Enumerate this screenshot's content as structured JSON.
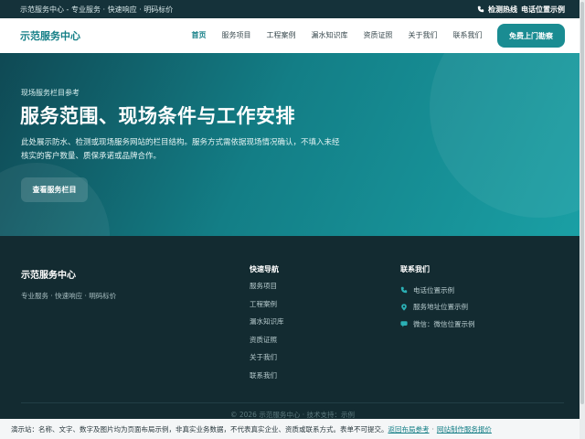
{
  "topbar": {
    "left_text": "示范服务中心 - 专业服务 · 快速响应 · 明码标价",
    "hotline_label": "检测热线",
    "hotline_value": "电话位置示例"
  },
  "header": {
    "logo": "示范服务中心",
    "nav": [
      {
        "label": "首页",
        "active": true
      },
      {
        "label": "服务项目",
        "active": false
      },
      {
        "label": "工程案例",
        "active": false
      },
      {
        "label": "漏水知识库",
        "active": false
      },
      {
        "label": "资质证照",
        "active": false
      },
      {
        "label": "关于我们",
        "active": false
      },
      {
        "label": "联系我们",
        "active": false
      }
    ],
    "cta_label": "免费上门勘察"
  },
  "hero": {
    "eyebrow": "现场服务栏目参考",
    "title": "服务范围、现场条件与工作安排",
    "description": "此处展示防水、检测或现场服务网站的栏目结构。服务方式需依据现场情况确认，不填入未经核实的客户数量、质保承诺或品牌合作。",
    "button_label": "查看服务栏目"
  },
  "footer": {
    "logo": "示范服务中心",
    "tagline": "专业服务 · 快速响应 · 明码标价",
    "quick_nav_title": "快速导航",
    "quick_nav": [
      "服务项目",
      "工程案例",
      "漏水知识库",
      "资质证照",
      "关于我们",
      "联系我们"
    ],
    "contact_title": "联系我们",
    "contact": [
      {
        "icon": "phone-icon",
        "text": "电话位置示例"
      },
      {
        "icon": "location-pin-icon",
        "text": "服务地址位置示例"
      },
      {
        "icon": "wechat-icon",
        "text": "微信：微信位置示例"
      }
    ],
    "copyright": "© 2026 示范服务中心 · 技术支持：示例"
  },
  "notice": {
    "text": "演示站：名称、文字、数字及图片均为页面布局示例，非真实业务数据，不代表真实企业、资质或联系方式。表单不可提交。",
    "link1": "返回布局参考",
    "separator": "·",
    "link2": "网站制作服务报价"
  },
  "colors": {
    "brand": "#137e86",
    "topbar_bg": "#15323a",
    "footer_bg": "#132b31",
    "cta_bg": "#1a8c92"
  }
}
